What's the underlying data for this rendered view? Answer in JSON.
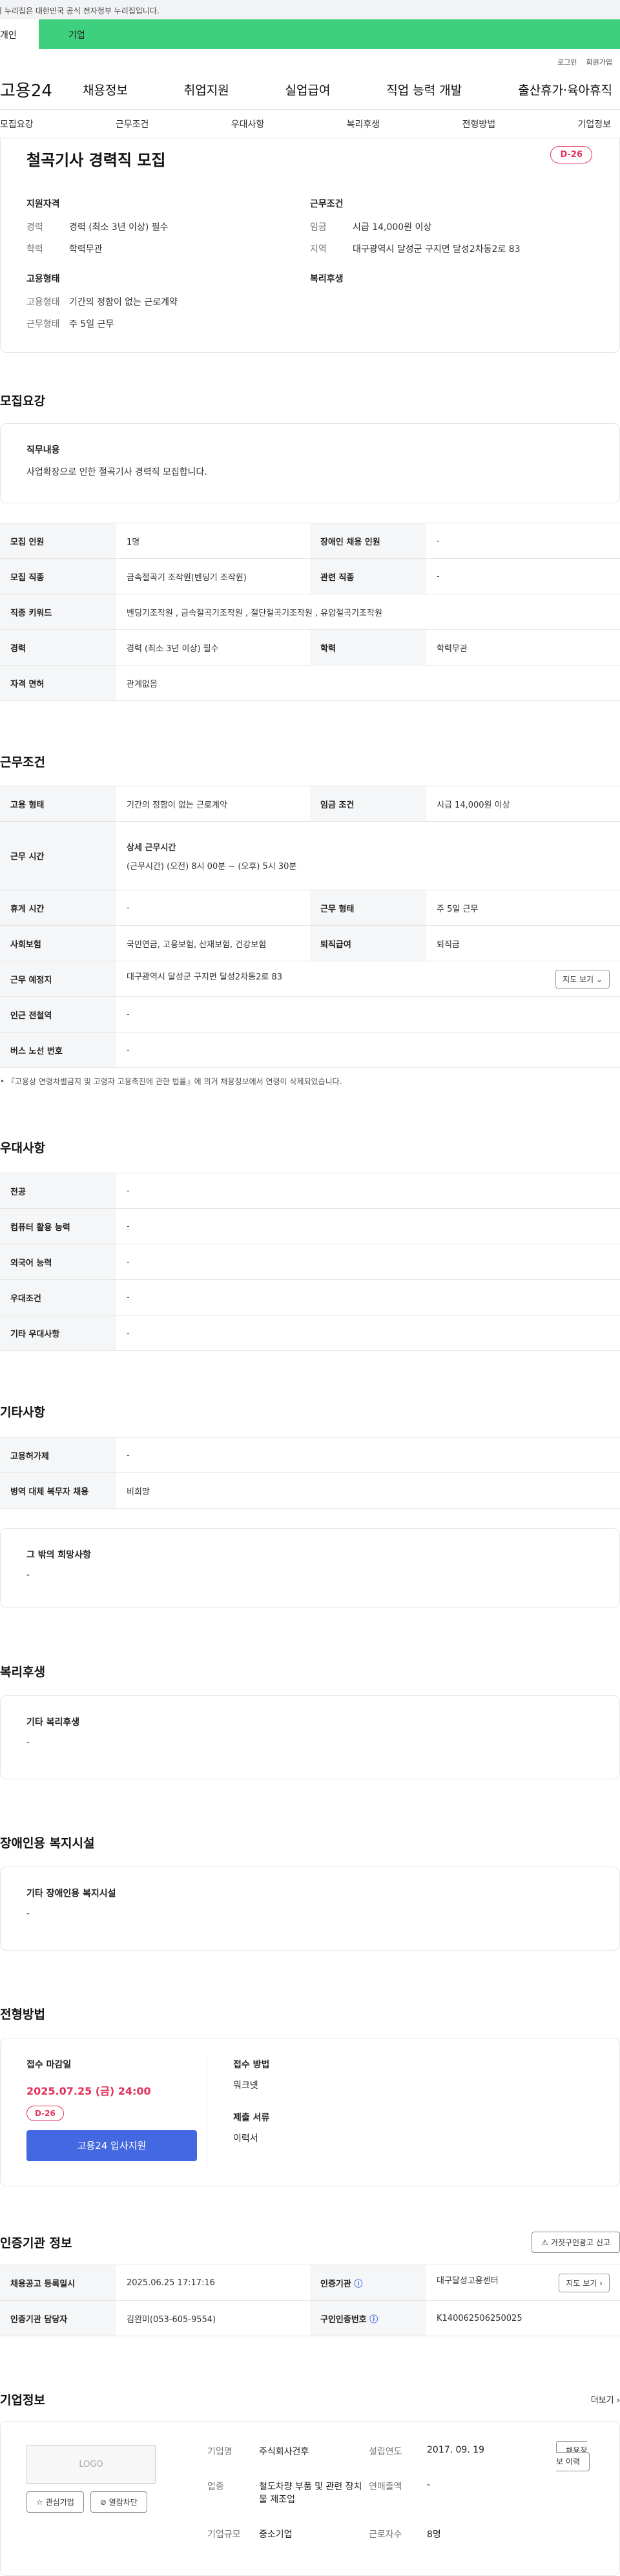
{
  "notice": "이 누리집은 대한민국 공식 전자정부 누리집입니다.",
  "usertabs": [
    "개인",
    "기업"
  ],
  "util": [
    "로그인",
    "회원가입"
  ],
  "logo": "고용24",
  "gnb": [
    "채용정보",
    "취업지원",
    "실업급여",
    "직업 능력 개발",
    "출산휴가·육아휴직"
  ],
  "snb": [
    "모집요강",
    "근무조건",
    "우대사항",
    "복리후생",
    "전형방법",
    "기업정보"
  ],
  "job": {
    "title": "철곡기사 경력직 모집",
    "dday": "D-26",
    "qual_h": "지원자격",
    "qual": [
      {
        "k": "경력",
        "v": "경력 (최소 3년 이상) 필수"
      },
      {
        "k": "학력",
        "v": "학력무관"
      }
    ],
    "cond_h": "근무조건",
    "cond": [
      {
        "k": "임금",
        "v": "시급 14,000원 이상"
      },
      {
        "k": "지역",
        "v": "대구광역시 달성군 구지면 달성2차동2로 83"
      }
    ],
    "emp_h": "고용형태",
    "emp": [
      {
        "k": "고용형태",
        "v": "기간의 정함이 없는 근로계약"
      },
      {
        "k": "근무형태",
        "v": "주 5일 근무"
      }
    ],
    "welfare_h": "복리후생"
  },
  "recruit": {
    "title": "모집요강",
    "duty_h": "직무내용",
    "duty": "사업확장으로 인한 절곡기사 경력직 모집합니다.",
    "rows": [
      {
        "k1": "모집 인원",
        "v1": "1명",
        "k2": "장애인 채용 인원",
        "v2": "-"
      },
      {
        "k1": "모집 직종",
        "v1": "금속절곡기 조작원(벤딩기 조작원)",
        "k2": "관련 직종",
        "v2": "-"
      },
      {
        "k1": "직종 키워드",
        "v1": "벤딩기조작원 , 금속절곡기조작원 , 절단절곡기조작원 , 유압절곡기조작원"
      },
      {
        "k1": "경력",
        "v1": "경력 (최소 3년 이상) 필수",
        "k2": "학력",
        "v2": "학력무관"
      },
      {
        "k1": "자격 면허",
        "v1": "관계없음"
      }
    ]
  },
  "work": {
    "title": "근무조건",
    "type_k": "고용 형태",
    "type_v": "기간의 정함이 없는 근로계약",
    "wage_k": "임금 조건",
    "wage_v": "시급 14,000원 이상",
    "time_k": "근무 시간",
    "time_h": "상세 근무시간",
    "time_v": "(근무시간) (오전) 8시 00분 ~ (오후) 5시 30분",
    "rest_k": "휴게 시간",
    "rest_v": "-",
    "form_k": "근무 형태",
    "form_v": "주 5일 근무",
    "ins_k": "사회보험",
    "ins_v": "국민연금, 고용보험, 산재보험, 건강보험",
    "ret_k": "퇴직급여",
    "ret_v": "퇴직금",
    "addr_k": "근무 예정지",
    "addr_v": "대구광역시 달성군 구지면 달성2차동2로 83",
    "map": "지도 보기",
    "sub_k": "인근 전철역",
    "sub_v": "-",
    "bus_k": "버스 노선 번호",
    "bus_v": "-",
    "note": "『고용상 연령차별금지 및 고령자 고용촉진에 관한 법률』에 의거 채용정보에서 연령이 삭제되었습니다."
  },
  "pref": {
    "title": "우대사항",
    "rows": [
      {
        "k": "전공",
        "v": "-"
      },
      {
        "k": "컴퓨터 활용 능력",
        "v": "-"
      },
      {
        "k": "외국어 능력",
        "v": "-"
      },
      {
        "k": "우대조건",
        "v": "-"
      },
      {
        "k": "기타 우대사항",
        "v": "-"
      }
    ]
  },
  "etc": {
    "title": "기타사항",
    "rows": [
      {
        "k": "고용허가제",
        "v": "-"
      },
      {
        "k": "병역 대체 복무자 채용",
        "v": "비희망"
      }
    ],
    "other_h": "그 밖의 희망사항",
    "other_v": "-"
  },
  "welfare": {
    "title": "복리후생",
    "h": "기타 복리후생",
    "v": "-"
  },
  "disabled": {
    "title": "장애인용 복지시설",
    "h": "기타 장애인용 복지시설",
    "v": "-"
  },
  "select": {
    "title": "전형방법",
    "deadline_h": "접수 마감일",
    "deadline": "2025.07.25 (금) 24:00",
    "dday": "D-26",
    "apply": "고용24 입사지원",
    "method_h": "접수 방법",
    "method": "워크넷",
    "docs_h": "제출 서류",
    "docs": "이력서"
  },
  "cert": {
    "title": "인증기관 정보",
    "report": "거짓구인광고 신고",
    "reg_k": "채용공고 등록일시",
    "reg_v": "2025.06.25 17:17:16",
    "org_k": "인증기관",
    "org_v": "대구달성고용센터",
    "map": "지도 보기",
    "mgr_k": "인증기관 담당자",
    "mgr_v": "김완미(053-605-9554)",
    "id_k": "구인인증번호",
    "id_v": "K140062506250025"
  },
  "company": {
    "title": "기업정보",
    "more": "더보기",
    "logo": "LOGO",
    "fav": "관심기업",
    "block": "열람차단",
    "hist": "채용정보 이력",
    "name_k": "기업명",
    "name_v": "주식회사건후",
    "est_k": "설립연도",
    "est_v": "2017. 09. 19",
    "ind_k": "업종",
    "ind_v": "철도차량 부품 및 관련 장치물 제조업",
    "sales_k": "연매출액",
    "sales_v": "-",
    "emp_k": "근로자수",
    "emp_v": "8명",
    "size_k": "기업규모",
    "size_v": "중소기업"
  }
}
